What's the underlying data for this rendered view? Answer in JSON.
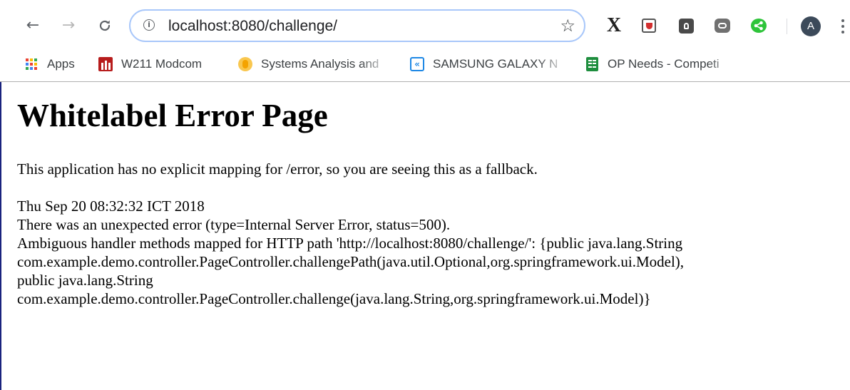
{
  "browser": {
    "nav": {
      "back_icon": "arrow-left-icon",
      "forward_icon": "arrow-right-icon",
      "reload_icon": "reload-icon"
    },
    "address_bar": {
      "url": "localhost:8080/challenge/",
      "info_icon": "info-icon",
      "bookmark_icon": "star-icon"
    },
    "extensions": [
      {
        "name": "x-extension-icon"
      },
      {
        "name": "pocket-shield-icon"
      },
      {
        "name": "lightbulb-extension-icon"
      },
      {
        "name": "chat-extension-icon"
      },
      {
        "name": "green-share-icon"
      }
    ],
    "profile": {
      "initial": "A"
    },
    "menu_icon": "more-vert-icon"
  },
  "bookmarks": [
    {
      "label": "Apps",
      "icon": "apps-grid-icon"
    },
    {
      "label": "W211 Modcom",
      "icon": "modcom-icon"
    },
    {
      "label": "Systems Analysis and",
      "icon": "systems-analysis-icon"
    },
    {
      "label": "SAMSUNG GALAXY N",
      "icon": "k-icon"
    },
    {
      "label": "OP Needs - Competi",
      "icon": "sheets-icon"
    }
  ],
  "page": {
    "title": "Whitelabel Error Page",
    "intro": "This application has no explicit mapping for /error, so you are seeing this as a fallback.",
    "details": [
      "Thu Sep 20 08:32:32 ICT 2018",
      "There was an unexpected error (type=Internal Server Error, status=500).",
      "Ambiguous handler methods mapped for HTTP path 'http://localhost:8080/challenge/': {public java.lang.String",
      "com.example.demo.controller.PageController.challengePath(java.util.Optional,org.springframework.ui.Model),",
      "public java.lang.String",
      "com.example.demo.controller.PageController.challenge(java.lang.String,org.springframework.ui.Model)}"
    ]
  },
  "colors": {
    "address_border": "#a8c7fa",
    "avatar_bg": "#3c4a5a",
    "left_edge": "#1a237e"
  }
}
